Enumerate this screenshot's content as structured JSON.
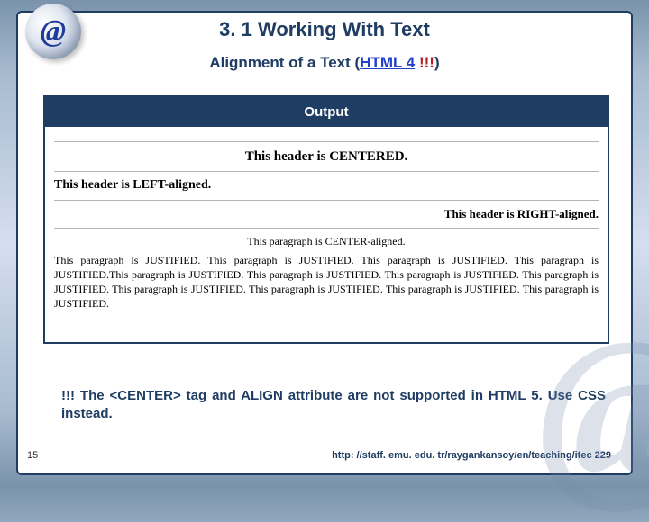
{
  "badge": {
    "glyph": "@"
  },
  "watermark": "@",
  "title": "3. 1 Working With Text",
  "subtitle": {
    "prefix": "Alignment of a Text (",
    "link": "HTML 4",
    "excl": " !!!",
    "suffix": ")"
  },
  "output": {
    "heading": "Output",
    "h_center": "This header is CENTERED.",
    "h_left": "This header is LEFT-aligned.",
    "h_right": "This header is RIGHT-aligned.",
    "p_center": "This paragraph is CENTER-aligned.",
    "p_justify": "This paragraph is JUSTIFIED. This paragraph is JUSTIFIED. This paragraph is JUSTIFIED. This paragraph is JUSTIFIED.This paragraph is JUSTIFIED. This paragraph is JUSTIFIED. This paragraph is JUSTIFIED. This paragraph is JUSTIFIED. This paragraph is JUSTIFIED. This paragraph is JUSTIFIED. This paragraph is JUSTIFIED. This paragraph is JUSTIFIED."
  },
  "note": "!!! The <CENTER> tag and ALIGN attribute are not supported in HTML 5. Use CSS instead.",
  "page_number": "15",
  "footer_url": "http: //staff. emu. edu. tr/raygankansoy/en/teaching/itec 229"
}
